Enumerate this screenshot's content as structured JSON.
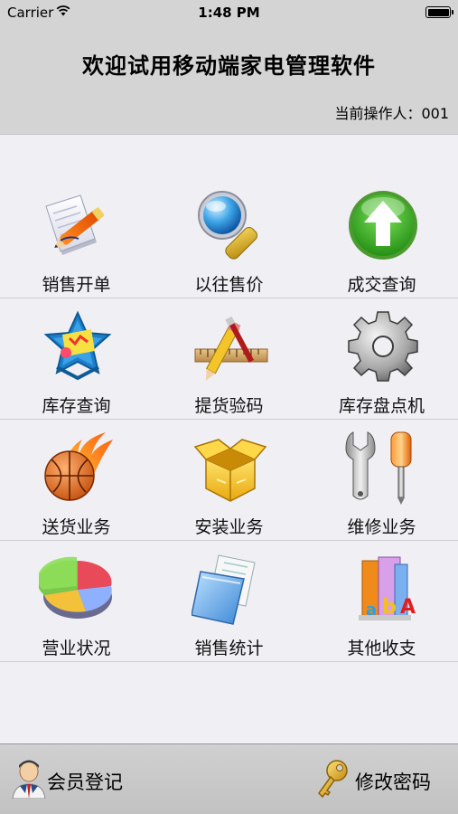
{
  "status_bar": {
    "carrier": "Carrier",
    "time": "1:48 PM"
  },
  "header": {
    "title": "欢迎试用移动端家电管理软件",
    "operator": "当前操作人：001"
  },
  "menu": [
    {
      "label": "销售开单",
      "icon": "sales-order-icon"
    },
    {
      "label": "以往售价",
      "icon": "magnifier-icon"
    },
    {
      "label": "成交查询",
      "icon": "up-arrow-icon"
    },
    {
      "label": "库存查询",
      "icon": "star-box-icon"
    },
    {
      "label": "提货验码",
      "icon": "pencil-ruler-icon"
    },
    {
      "label": "库存盘点机",
      "icon": "gear-icon"
    },
    {
      "label": "送货业务",
      "icon": "fire-basketball-icon"
    },
    {
      "label": "安装业务",
      "icon": "open-box-icon"
    },
    {
      "label": "维修业务",
      "icon": "wrench-screwdriver-icon"
    },
    {
      "label": "营业状况",
      "icon": "pie-chart-icon"
    },
    {
      "label": "销售统计",
      "icon": "documents-icon"
    },
    {
      "label": "其他收支",
      "icon": "books-icon"
    }
  ],
  "bottom_bar": {
    "member_label": "会员登记",
    "password_label": "修改密码"
  },
  "colors": {
    "header_bg": "#d4d4d4",
    "page_bg": "#efeff4",
    "bottom_bg": "#c8c8c8"
  }
}
